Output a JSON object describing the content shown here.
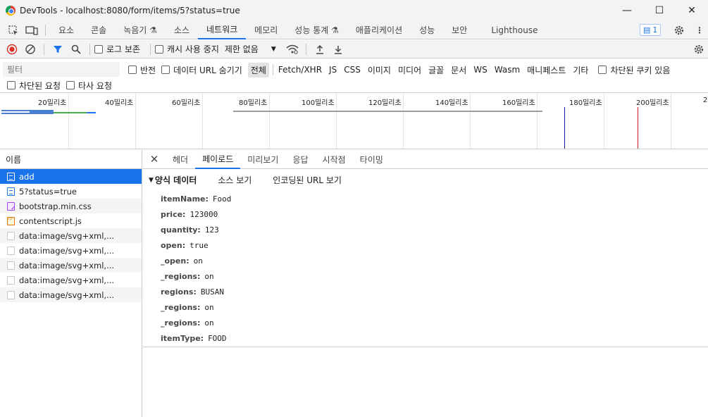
{
  "window": {
    "title": "DevTools - localhost:8080/form/items/5?status=true"
  },
  "panels": [
    "요소",
    "콘솔",
    "녹음기",
    "소스",
    "네트워크",
    "메모리",
    "성능 통계",
    "애플리케이션",
    "성능",
    "보안",
    "Lighthouse"
  ],
  "issues_count": "1",
  "network_toolbar": {
    "preserve_log": "로그 보존",
    "disable_cache": "캐시 사용 중지",
    "throttling": "제한 없음"
  },
  "filter": {
    "placeholder": "필터",
    "invert": "반전",
    "hide_data_urls": "데이터 URL 숨기기",
    "types": [
      "전체",
      "Fetch/XHR",
      "JS",
      "CSS",
      "이미지",
      "미디어",
      "글꼴",
      "문서",
      "WS",
      "Wasm",
      "매니페스트",
      "기타"
    ],
    "blocked_cookies": "차단된 쿠키 있음",
    "blocked_requests": "차단된 요청",
    "third_party": "타사 요청"
  },
  "timeline_ticks": [
    "20밀리초",
    "40밀리초",
    "60밀리초",
    "80밀리초",
    "100밀리초",
    "120밀리초",
    "140밀리초",
    "160밀리초",
    "180밀리초",
    "200밀리초",
    "2"
  ],
  "requests": {
    "header": "이름",
    "items": [
      {
        "name": "add",
        "type": "doc"
      },
      {
        "name": "5?status=true",
        "type": "doc"
      },
      {
        "name": "bootstrap.min.css",
        "type": "css"
      },
      {
        "name": "contentscript.js",
        "type": "js"
      },
      {
        "name": "data:image/svg+xml,...",
        "type": "img"
      },
      {
        "name": "data:image/svg+xml,...",
        "type": "img"
      },
      {
        "name": "data:image/svg+xml,...",
        "type": "img"
      },
      {
        "name": "data:image/svg+xml,...",
        "type": "img"
      },
      {
        "name": "data:image/svg+xml,...",
        "type": "img"
      }
    ]
  },
  "detail": {
    "tabs": [
      "헤더",
      "페이로드",
      "미리보기",
      "응답",
      "시작점",
      "타이밍"
    ],
    "section_title": "양식 데이터",
    "view_source": "소스 보기",
    "view_url_encoded": "인코딩된 URL 보기",
    "params": [
      {
        "key": "itemName:",
        "value": "Food"
      },
      {
        "key": "price:",
        "value": "123000"
      },
      {
        "key": "quantity:",
        "value": "123"
      },
      {
        "key": "open:",
        "value": "true"
      },
      {
        "key": "_open:",
        "value": "on"
      },
      {
        "key": "_regions:",
        "value": "on"
      },
      {
        "key": "regions:",
        "value": "BUSAN"
      },
      {
        "key": "_regions:",
        "value": "on"
      },
      {
        "key": "_regions:",
        "value": "on"
      },
      {
        "key": "itemType:",
        "value": "FOOD"
      }
    ]
  }
}
